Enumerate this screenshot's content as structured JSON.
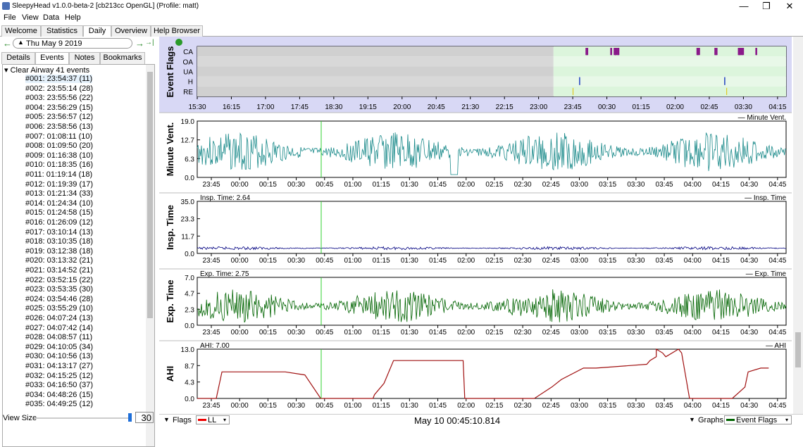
{
  "window": {
    "title": "SleepyHead v1.0.0-beta-2 [cb213cc OpenGL] (Profile: matt)",
    "minimize": "—",
    "restore": "❐",
    "close": "✕"
  },
  "menu": [
    "File",
    "View",
    "Data",
    "Help"
  ],
  "tabs": [
    "Welcome",
    "Statistics",
    "Daily",
    "Overview",
    "Help Browser"
  ],
  "active_tab": "Daily",
  "date": {
    "prev": "←",
    "value": "Thu May 9 2019",
    "next": "→",
    "last": "→|"
  },
  "subtabs": [
    "Details",
    "Events",
    "Notes",
    "Bookmarks"
  ],
  "events": {
    "group": "Clear Airway 41 events",
    "items": [
      "#001: 23:54:37 (11)",
      "#002: 23:55:14 (28)",
      "#003: 23:55:56 (22)",
      "#004: 23:56:29 (15)",
      "#005: 23:56:57 (12)",
      "#006: 23:58:56 (13)",
      "#007: 01:08:11 (10)",
      "#008: 01:09:50 (20)",
      "#009: 01:16:38 (10)",
      "#010: 01:18:35 (16)",
      "#011: 01:19:14 (18)",
      "#012: 01:19:39 (17)",
      "#013: 01:21:34 (33)",
      "#014: 01:24:34 (10)",
      "#015: 01:24:58 (15)",
      "#016: 01:26:09 (12)",
      "#017: 03:10:14 (13)",
      "#018: 03:10:35 (18)",
      "#019: 03:12:38 (18)",
      "#020: 03:13:32 (21)",
      "#021: 03:14:52 (21)",
      "#022: 03:52:15 (22)",
      "#023: 03:53:35 (30)",
      "#024: 03:54:46 (28)",
      "#025: 03:55:29 (10)",
      "#026: 04:07:24 (13)",
      "#027: 04:07:42 (14)",
      "#028: 04:08:57 (11)",
      "#029: 04:10:05 (34)",
      "#030: 04:10:56 (13)",
      "#031: 04:13:17 (27)",
      "#032: 04:15:25 (12)",
      "#033: 04:16:50 (37)",
      "#034: 04:48:26 (15)",
      "#035: 04:49:25 (12)"
    ]
  },
  "view_size": {
    "label": "View Size",
    "value": "30"
  },
  "flags_panel": {
    "title": "Event Flags",
    "rows": [
      "CA",
      "OA",
      "UA",
      "H",
      "RE"
    ],
    "time_ticks": [
      "15:30",
      "16:15",
      "17:00",
      "17:45",
      "18:30",
      "19:15",
      "20:00",
      "20:45",
      "21:30",
      "22:15",
      "23:00",
      "23:45",
      "00:30",
      "01:15",
      "02:00",
      "02:45",
      "03:30",
      "04:15"
    ],
    "ca_events": [
      0.5,
      0.51,
      0.52,
      0.53,
      1.08,
      1.09,
      1.16,
      1.18,
      1.19,
      1.19,
      1.21,
      1.24,
      1.25,
      1.26,
      3.1,
      3.11,
      3.12,
      3.13,
      3.15,
      3.52,
      3.53,
      3.55,
      3.56,
      4.07,
      4.08,
      4.09,
      4.1,
      4.11,
      4.13,
      4.15,
      4.16,
      4.18,
      4.48,
      4.49
    ],
    "h_events": [
      0.35,
      3.75
    ],
    "re_events": [
      0.2,
      3.8
    ]
  },
  "time_ticks": [
    "23:45",
    "00:00",
    "00:15",
    "00:30",
    "00:45",
    "01:00",
    "01:15",
    "01:30",
    "01:45",
    "02:00",
    "02:15",
    "02:30",
    "02:45",
    "03:00",
    "03:15",
    "03:30",
    "03:45",
    "04:00",
    "04:15",
    "04:30",
    "04:45"
  ],
  "panels": [
    {
      "title": "Minute Vent.",
      "legend": "Minute Vent.",
      "yticks": [
        "19.0",
        "12.7",
        "6.3",
        "0.0"
      ],
      "color": "#1a8a8a"
    },
    {
      "title": "Insp. Time",
      "legend": "Insp. Time",
      "readout": "Insp. Time: 2.64",
      "yticks": [
        "35.0",
        "23.3",
        "11.7",
        "0.0"
      ],
      "color": "#000080"
    },
    {
      "title": "Exp. Time",
      "legend": "Exp. Time",
      "readout": "Exp. Time: 2.75",
      "yticks": [
        "7.0",
        "4.7",
        "2.3",
        "0.0"
      ],
      "color": "#006400"
    },
    {
      "title": "AHI",
      "legend": "AHI",
      "readout": "AHI: 7.00",
      "yticks": [
        "13.0",
        "8.7",
        "4.3",
        "0.0"
      ],
      "color": "#a01010"
    }
  ],
  "ahi_data": {
    "x": [
      0,
      0.6,
      0.78,
      2.45,
      2.78,
      3.4,
      3.9,
      4.1,
      5.55,
      5.6,
      5.9,
      6.2,
      8.4,
      8.45,
      10.6,
      10.65,
      11.2,
      11.5,
      12.2,
      12.6,
      14.2,
      14.3,
      14.5,
      14.5,
      14.7,
      14.8,
      15.2,
      15.3,
      15.55,
      15.6,
      16.9,
      17.3,
      17.4,
      17.8,
      18.05
    ],
    "y": [
      0,
      0,
      7.0,
      7.0,
      7.0,
      6.2,
      0,
      0,
      0,
      1,
      4,
      10,
      10,
      0,
      0,
      0,
      3,
      5,
      8,
      8,
      9,
      10,
      11,
      13,
      12,
      11,
      13,
      12,
      0,
      0,
      0,
      3,
      7,
      8,
      8
    ]
  },
  "crosshair": {
    "time": "00:45"
  },
  "bottom": {
    "flags": "Flags",
    "ll": "LL",
    "status": "May 10 00:45:10.814",
    "graphs": "Graphs",
    "event_flags": "Event Flags"
  }
}
